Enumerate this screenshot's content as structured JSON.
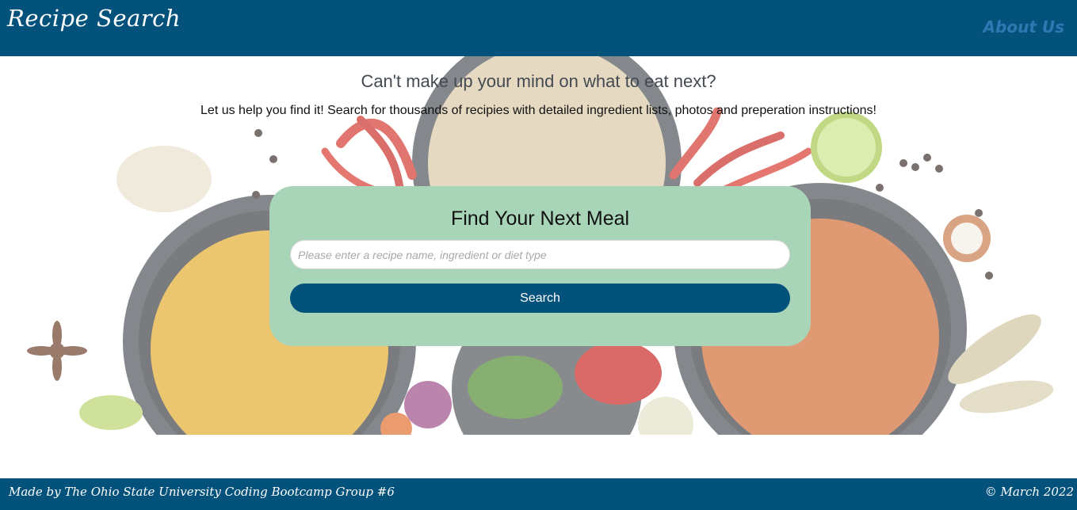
{
  "header": {
    "brand": "Recipe Search",
    "about_link": "About Us"
  },
  "hero": {
    "tagline": "Can't make up your mind on what to eat next?",
    "subline": "Let us help you find it! Search for thousands of recipies with detailed ingredient lists, photos and preperation instructions!"
  },
  "search": {
    "title": "Find Your Next Meal",
    "placeholder": "Please enter a recipe name, ingredient or diet type",
    "value": "",
    "button_label": "Search"
  },
  "footer": {
    "credit": "Made by The Ohio State University Coding Bootcamp Group #6",
    "copyright": "© March 2022"
  },
  "colors": {
    "brand": "#03527b",
    "card": "#a8d5b8",
    "about_link": "#2f78b3"
  }
}
